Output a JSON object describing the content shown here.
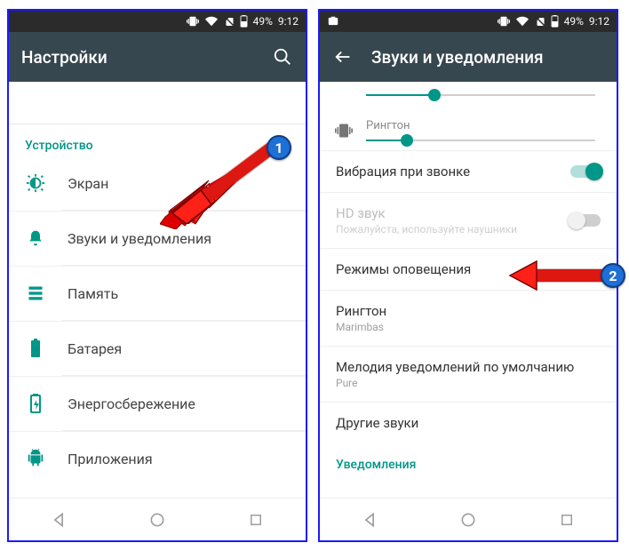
{
  "status": {
    "battery_text": "49%",
    "time": "9:12"
  },
  "left": {
    "app_title": "Настройки",
    "section_header": "Устройство",
    "items": [
      {
        "label": "Экран"
      },
      {
        "label": "Звуки и уведомления"
      },
      {
        "label": "Память"
      },
      {
        "label": "Батарея"
      },
      {
        "label": "Энергосбережение"
      },
      {
        "label": "Приложения"
      }
    ]
  },
  "right": {
    "app_title": "Звуки и уведомления",
    "sliders": {
      "ringtone_label": "Рингтон",
      "prev_fill_pct": 30,
      "ringtone_fill_pct": 18
    },
    "rows": {
      "vibrate": {
        "title": "Вибрация при звонке",
        "on": true
      },
      "hd": {
        "title": "HD звук",
        "sub": "Пожалуйста, используйте наушники",
        "on": false
      },
      "modes": {
        "title": "Режимы оповещения"
      },
      "ring": {
        "title": "Рингтон",
        "sub": "Marimbas"
      },
      "notif": {
        "title": "Мелодия уведомлений по умолчанию",
        "sub": "Pure"
      },
      "other": {
        "title": "Другие звуки"
      }
    },
    "section2": "Уведомления"
  },
  "annotations": {
    "badge1": "1",
    "badge2": "2"
  }
}
